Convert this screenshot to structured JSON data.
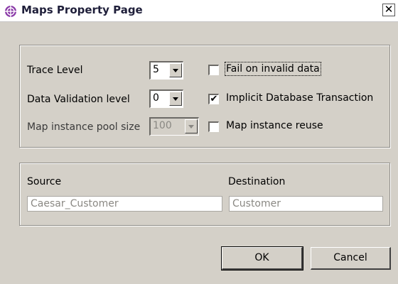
{
  "window": {
    "title": "Maps Property Page",
    "close_glyph": "✕"
  },
  "settings": {
    "trace_level": {
      "label": "Trace Level",
      "value": "5"
    },
    "data_validation": {
      "label": "Data Validation level",
      "value": "0"
    },
    "pool_size": {
      "label": "Map instance pool size",
      "value": "100",
      "disabled": true
    },
    "fail_on_invalid": {
      "label": "Fail on invalid data",
      "checked": false
    },
    "implicit_txn": {
      "label": "Implicit Database Transaction",
      "checked": true
    },
    "instance_reuse": {
      "label": "Map instance reuse",
      "checked": false
    }
  },
  "maps": {
    "source": {
      "label": "Source",
      "value": "Caesar_Customer"
    },
    "destination": {
      "label": "Destination",
      "value": "Customer"
    }
  },
  "buttons": {
    "ok": "OK",
    "cancel": "Cancel"
  },
  "icons": {
    "app": "maps-property-app-icon",
    "dropdown": "chevron-down-icon",
    "check": "checkmark-icon"
  },
  "colors": {
    "dialog_bg": "#d4d0c8",
    "titlebar_bg": "#ffffff",
    "icon_purple": "#8a3aa8"
  }
}
